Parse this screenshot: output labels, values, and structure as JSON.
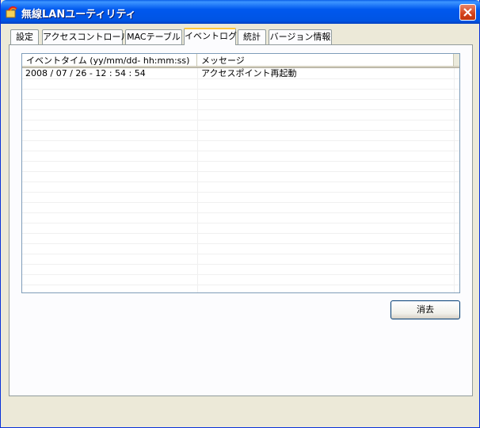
{
  "window": {
    "title": "無線LANユーティリティ"
  },
  "tabs": [
    {
      "label": "設定",
      "active": false
    },
    {
      "label": "アクセスコントロール",
      "active": false
    },
    {
      "label": "MACテーブル",
      "active": false
    },
    {
      "label": "イベントログ",
      "active": true
    },
    {
      "label": "統計",
      "active": false
    },
    {
      "label": "バージョン情報",
      "active": false
    }
  ],
  "event_log": {
    "columns": [
      "イベントタイム (yy/mm/dd- hh:mm:ss)",
      "メッセージ"
    ],
    "rows": [
      {
        "time": "2008 / 07 / 26 - 12 : 54 : 54",
        "message": "アクセスポイント再起動"
      }
    ]
  },
  "buttons": {
    "clear_label": "消去"
  }
}
